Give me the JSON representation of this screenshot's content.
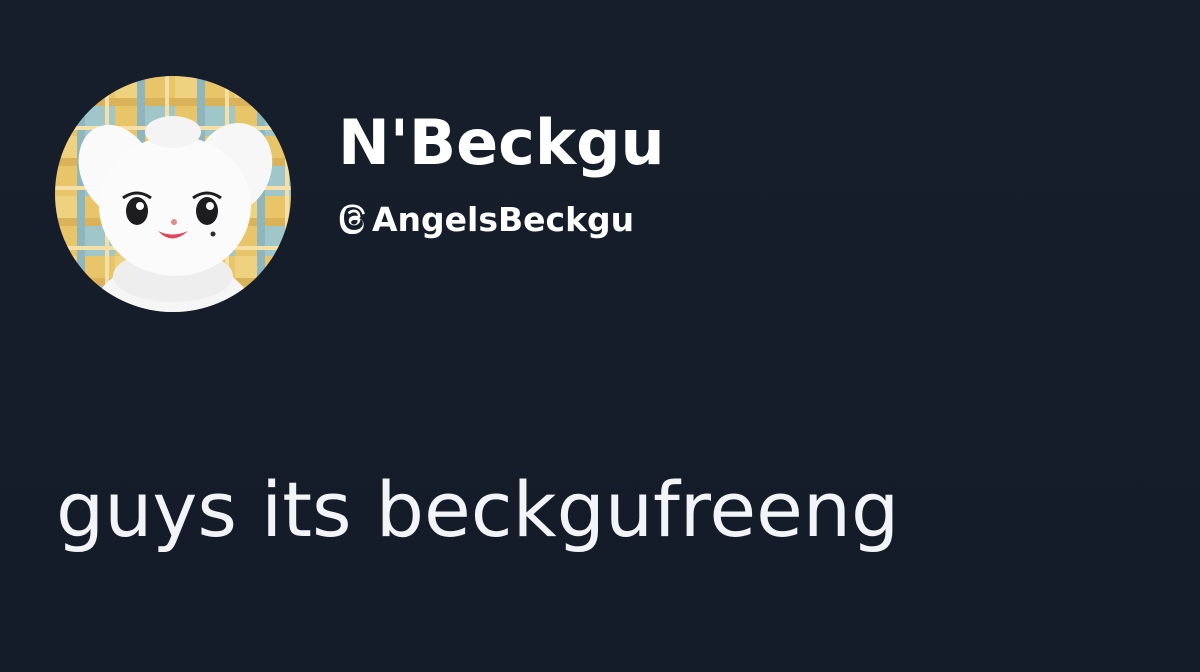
{
  "post": {
    "author": {
      "display_name": "N'Beckgu",
      "handle": "AngelsBeckgu",
      "handle_icon": "threads-icon",
      "avatar": "plush-avatar"
    },
    "text": "guys its beckgufreeng"
  },
  "colors": {
    "background": "#151d2a",
    "text": "#ffffff"
  }
}
